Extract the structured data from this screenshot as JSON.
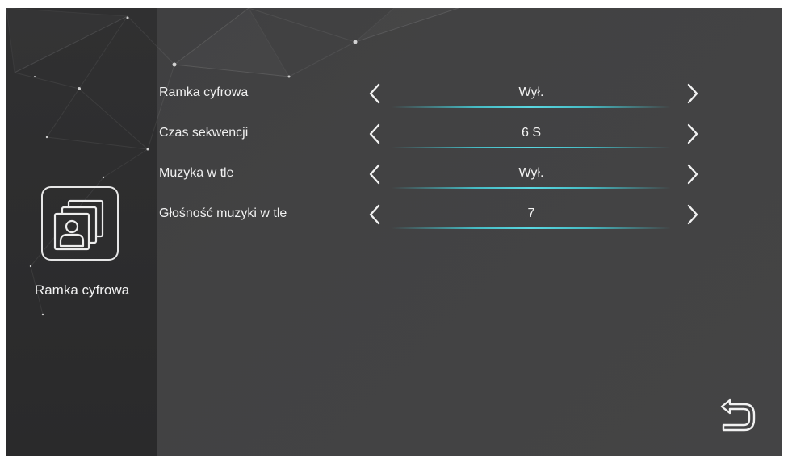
{
  "sidebar": {
    "app_name": "Ramka cyfrowa",
    "app_icon": "digital-frame-icon"
  },
  "settings": [
    {
      "label": "Ramka cyfrowa",
      "value": "Wył."
    },
    {
      "label": "Czas sekwencji",
      "value": "6 S"
    },
    {
      "label": "Muzyka w tle",
      "value": "Wył."
    },
    {
      "label": "Głośność muzyki w tle",
      "value": "7"
    }
  ],
  "icons": {
    "left": "chevron-left-icon",
    "right": "chevron-right-icon",
    "back": "back-return-icon"
  },
  "colors": {
    "accent": "#46c8d2",
    "background": "#424243",
    "sidebar": "#2d2d2e",
    "text": "#f0f0f0"
  }
}
